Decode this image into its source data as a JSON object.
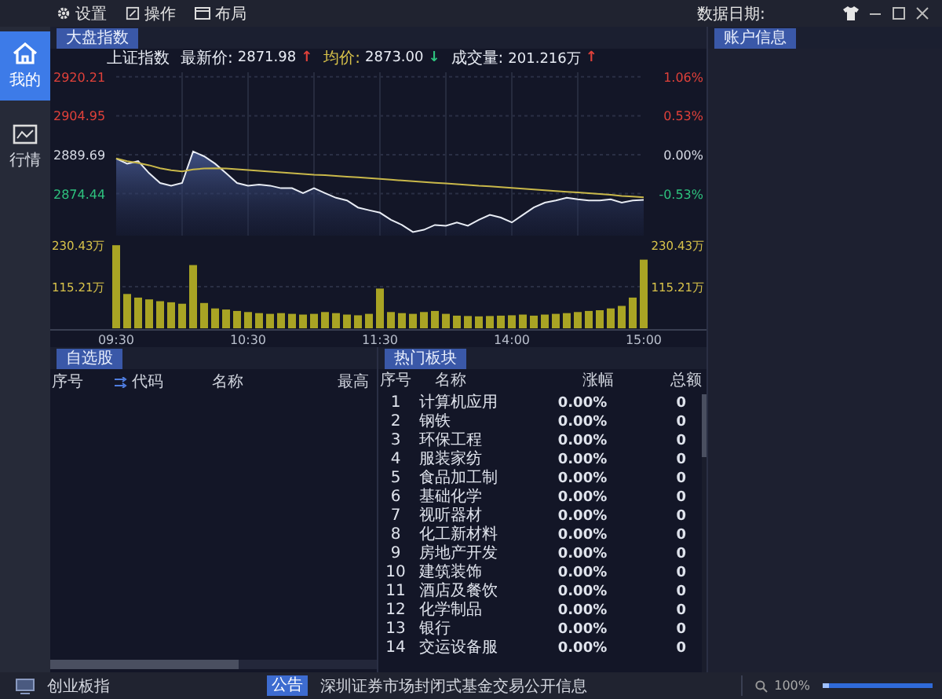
{
  "menu": [
    {
      "kind": "settings",
      "label": "设置"
    },
    {
      "kind": "operate",
      "label": "操作"
    },
    {
      "kind": "layout",
      "label": "布局"
    }
  ],
  "data_date_label": "数据日期:",
  "sidebar": {
    "items": [
      {
        "kind": "home",
        "label": "我的",
        "selected": true
      },
      {
        "kind": "market",
        "label": "行情",
        "selected": false
      }
    ]
  },
  "index_panel": {
    "tab": {
      "label": "大盘指数",
      "selected": true
    },
    "info": [
      {
        "kind": "name",
        "label": "上证指数"
      },
      {
        "kind": "price",
        "label": "最新价:",
        "value": "2871.98",
        "arrow": "↑",
        "color": "#e0413a"
      },
      {
        "kind": "average",
        "label": "均价:",
        "value": "2873.00",
        "arrow": "↓",
        "color": "#2ec27e"
      },
      {
        "kind": "volume",
        "label": "成交量:",
        "value": "201.216万",
        "arrow": "↑",
        "color": "#e0413a"
      }
    ],
    "price_chart": {
      "chart_data": {
        "type": "line",
        "grid": true,
        "categories": [
          null,
          null,
          null,
          null,
          null,
          null,
          null,
          null,
          null,
          null,
          null,
          null,
          null,
          null,
          null,
          null,
          null,
          null,
          null,
          null,
          null,
          null,
          null,
          null,
          null,
          null,
          null,
          null,
          null,
          null,
          null,
          null,
          null,
          null,
          null,
          null,
          null,
          null,
          null,
          null,
          null,
          null,
          null,
          null,
          null,
          null,
          null,
          null,
          null
        ],
        "ylim": [
          2858,
          2922
        ],
        "yticks": [
          {
            "value": 2920.21,
            "label": "2920.21"
          },
          {
            "value": 2904.95,
            "label": "2904.95"
          },
          {
            "value": 2889.69,
            "label": "2889.69"
          },
          {
            "value": 2874.44,
            "label": "2874.44"
          }
        ],
        "series": [
          {
            "color": "#e8ecf4",
            "values": [
              2888.2,
              2886.2,
              2887.2,
              2882.4,
              2878.6,
              2877.6,
              2878.6,
              2891.0,
              2889.1,
              2886.2,
              2882.4,
              2878.6,
              2877.6,
              2878.0,
              2877.6,
              2876.6,
              2876.6,
              2874.7,
              2876.6,
              2874.7,
              2872.8,
              2871.8,
              2869.0,
              2868.0,
              2867.0,
              2864.2,
              2862.2,
              2859.4,
              2860.3,
              2862.2,
              2861.9,
              2863.2,
              2861.9,
              2864.2,
              2866.1,
              2865.1,
              2863.2,
              2866.1,
              2869.0,
              2870.9,
              2871.8,
              2872.8,
              2872.2,
              2871.8,
              2871.8,
              2872.2,
              2870.9,
              2871.8,
              2872.0
            ]
          },
          {
            "color": "#c9b84a",
            "values": [
              2888.2,
              2887.2,
              2886.5,
              2885.6,
              2884.4,
              2883.6,
              2883.2,
              2883.9,
              2884.3,
              2884.4,
              2884.3,
              2884.0,
              2883.7,
              2883.4,
              2883.1,
              2882.8,
              2882.5,
              2882.2,
              2881.9,
              2881.7,
              2881.4,
              2881.1,
              2880.8,
              2880.5,
              2880.2,
              2879.9,
              2879.6,
              2879.3,
              2879.0,
              2878.7,
              2878.4,
              2878.1,
              2877.8,
              2877.5,
              2877.3,
              2877.0,
              2876.7,
              2876.4,
              2876.1,
              2875.8,
              2875.5,
              2875.2,
              2874.9,
              2874.6,
              2874.3,
              2874.0,
              2873.6,
              2873.3,
              2873.0
            ]
          }
        ]
      },
      "right_axis_labels": [
        "1.06%",
        "0.53%",
        "0.00%",
        "-0.53%"
      ]
    },
    "volume_chart": {
      "chart_data": {
        "type": "bar",
        "categories": [
          "09:30",
          null,
          null,
          null,
          null,
          null,
          null,
          null,
          null,
          null,
          null,
          null,
          "10:30",
          null,
          null,
          null,
          null,
          null,
          null,
          null,
          null,
          null,
          null,
          null,
          "11:30",
          null,
          null,
          null,
          null,
          null,
          null,
          null,
          null,
          null,
          null,
          null,
          "14:00",
          null,
          null,
          null,
          null,
          null,
          null,
          null,
          null,
          null,
          null,
          null,
          "15:00"
        ],
        "ylim": [
          0,
          230.43
        ],
        "yticks": [
          {
            "value": 230.43,
            "label": "230.43万"
          },
          {
            "value": 115.21,
            "label": "115.21万"
          }
        ],
        "series": [
          {
            "color": "#a9a424",
            "values": [
              230,
              95,
              85,
              80,
              75,
              72,
              68,
              175,
              70,
              55,
              52,
              48,
              45,
              42,
              40,
              42,
              40,
              38,
              40,
              45,
              42,
              38,
              36,
              40,
              110,
              45,
              42,
              40,
              45,
              48,
              40,
              35,
              34,
              33,
              34,
              35,
              36,
              38,
              35,
              38,
              40,
              42,
              45,
              48,
              50,
              55,
              62,
              85,
              190
            ]
          }
        ]
      }
    }
  },
  "watchlist": {
    "tab": {
      "label": "自选股",
      "selected": true
    },
    "columns": [
      "序号",
      "代码",
      "名称",
      "最高"
    ]
  },
  "hot_sectors": {
    "tab": {
      "label": "热门板块",
      "selected": true
    },
    "columns": [
      "序号",
      "名称",
      "涨幅",
      "总额"
    ],
    "rows": [
      [
        "1",
        "计算机应用",
        "0.00%",
        "0"
      ],
      [
        "2",
        "钢铁",
        "0.00%",
        "0"
      ],
      [
        "3",
        "环保工程",
        "0.00%",
        "0"
      ],
      [
        "4",
        "服装家纺",
        "0.00%",
        "0"
      ],
      [
        "5",
        "食品加工制",
        "0.00%",
        "0"
      ],
      [
        "6",
        "基础化学",
        "0.00%",
        "0"
      ],
      [
        "7",
        "视听器材",
        "0.00%",
        "0"
      ],
      [
        "8",
        "化工新材料",
        "0.00%",
        "0"
      ],
      [
        "9",
        "房地产开发",
        "0.00%",
        "0"
      ],
      [
        "10",
        "建筑装饰",
        "0.00%",
        "0"
      ],
      [
        "11",
        "酒店及餐饮",
        "0.00%",
        "0"
      ],
      [
        "12",
        "化学制品",
        "0.00%",
        "0"
      ],
      [
        "13",
        "银行",
        "0.00%",
        "0"
      ],
      [
        "14",
        "交运设备服",
        "0.00%",
        "0"
      ]
    ]
  },
  "account_panel": {
    "tab": {
      "label": "账户信息",
      "selected": true
    }
  },
  "status_bar": {
    "index_name": "创业板指",
    "notice_badge": "公告",
    "notice": "深圳证券市场封闭式基金交易公开信息",
    "zoom": "100%",
    "zoom_slider": {
      "level": 0.05
    }
  }
}
